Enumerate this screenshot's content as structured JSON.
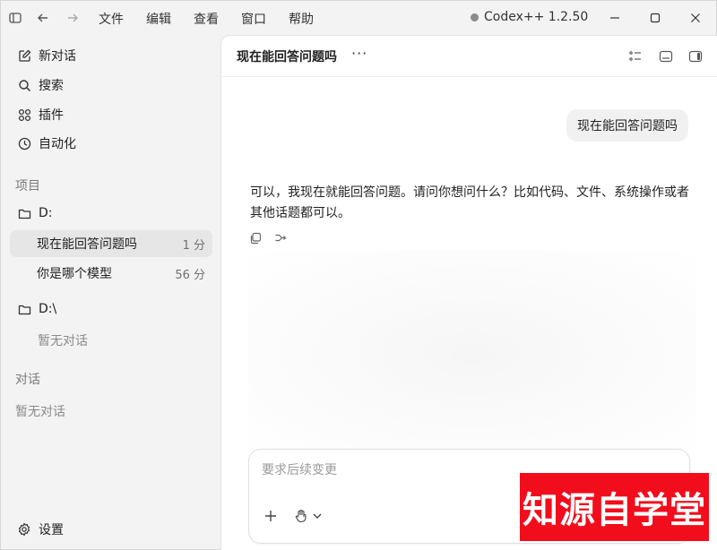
{
  "titlebar": {
    "menu": [
      "文件",
      "编辑",
      "查看",
      "窗口",
      "帮助"
    ],
    "app_title": "Codex++ 1.2.50"
  },
  "sidebar": {
    "nav": [
      {
        "label": "新对话",
        "icon": "new-chat-icon"
      },
      {
        "label": "搜索",
        "icon": "search-icon"
      },
      {
        "label": "插件",
        "icon": "plugins-icon"
      },
      {
        "label": "自动化",
        "icon": "clock-icon"
      }
    ],
    "projects_label": "项目",
    "projects": [
      {
        "name": "D:",
        "threads": [
          {
            "title": "现在能回答问题吗",
            "time": "1 分",
            "active": true
          },
          {
            "title": "你是哪个模型",
            "time": "56 分",
            "active": false
          }
        ]
      },
      {
        "name": "D:\\",
        "empty_note": "暂无对话"
      }
    ],
    "chats_label": "对话",
    "chats_empty": "暂无对话",
    "settings_label": "设置"
  },
  "main": {
    "thread_title": "现在能回答问题吗",
    "more": "···",
    "user_message": "现在能回答问题吗",
    "assistant_message": "可以，我现在就能回答问题。请问你想问什么？比如代码、文件、系统操作或者其他话题都可以。",
    "composer_placeholder": "要求后续变更"
  },
  "watermark": "知源自学堂"
}
